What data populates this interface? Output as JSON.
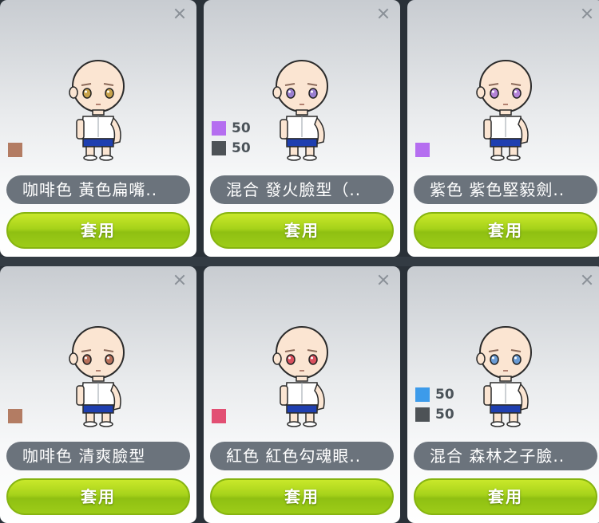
{
  "cards": [
    {
      "name": "咖啡色  黃色扁嘴..",
      "apply_label": "套用",
      "eye_color": "#c8a24a",
      "swatches": [
        {
          "color": "#b37c63",
          "value": ""
        }
      ]
    },
    {
      "name": "混合  發火臉型（..",
      "apply_label": "套用",
      "eye_color": "#9a7fd0",
      "swatches": [
        {
          "color": "#b56ef0",
          "value": "50"
        },
        {
          "color": "#4d5256",
          "value": "50"
        }
      ]
    },
    {
      "name": "紫色  紫色堅毅劍..",
      "apply_label": "套用",
      "eye_color": "#b583d8",
      "swatches": [
        {
          "color": "#b56ef0",
          "value": ""
        }
      ]
    },
    {
      "name": "咖啡色  清爽臉型",
      "apply_label": "套用",
      "eye_color": "#b8705a",
      "swatches": [
        {
          "color": "#b37c63",
          "value": ""
        }
      ]
    },
    {
      "name": "紅色  紅色勾魂眼..",
      "apply_label": "套用",
      "eye_color": "#d9505e",
      "swatches": [
        {
          "color": "#e24f73",
          "value": ""
        }
      ]
    },
    {
      "name": "混合  森林之子臉..",
      "apply_label": "套用",
      "eye_color": "#6a9bd4",
      "swatches": [
        {
          "color": "#3d9bea",
          "value": "50"
        },
        {
          "color": "#4d5256",
          "value": "50"
        }
      ]
    }
  ]
}
